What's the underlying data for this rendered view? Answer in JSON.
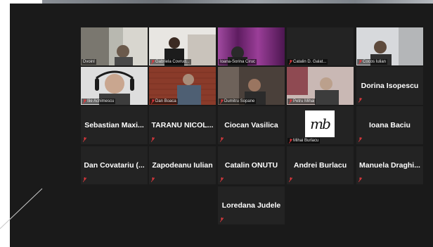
{
  "meeting": {
    "participants": [
      {
        "name": "Dvoinl",
        "view": "video"
      },
      {
        "name": "Gabriela Covrud...",
        "view": "video"
      },
      {
        "name": "Ioana-Sorina Ciruc",
        "view": "video",
        "active": true
      },
      {
        "name": "Catalin D. Galat...",
        "view": "video"
      },
      {
        "name": "Cocos Iulian",
        "view": "video"
      },
      {
        "name": "Ilie Achimescu",
        "view": "video"
      },
      {
        "name": "Dan Boaca",
        "view": "video"
      },
      {
        "name": "Dumitru Sopane",
        "view": "video"
      },
      {
        "name": "Petru Mihai",
        "view": "video"
      },
      {
        "name": "Dorina Isopescu",
        "view": "name"
      },
      {
        "name": "Sebastian Maxi...",
        "view": "name"
      },
      {
        "name": "TARANU NICOL...",
        "view": "name"
      },
      {
        "name": "Ciocan Vasilica",
        "view": "name"
      },
      {
        "name": "mb",
        "caption": "Mihai Burlacu",
        "view": "logo"
      },
      {
        "name": "Ioana Baciu",
        "view": "name"
      },
      {
        "name": "Dan Covatariu (...",
        "view": "name"
      },
      {
        "name": "Zapodeanu Iulian",
        "view": "name"
      },
      {
        "name": "Catalin ONUTU",
        "view": "name"
      },
      {
        "name": "Andrei Burlacu",
        "view": "name"
      },
      {
        "name": "Manuela Draghi...",
        "view": "name"
      },
      {
        "name": "Loredana Judele",
        "view": "name"
      }
    ]
  },
  "colors": {
    "background": "#1a1a1a",
    "tile": "#232323",
    "active_speaker": "#9bd12f",
    "muted_mic": "#e0393e"
  },
  "icons": {
    "muted": "microphone-muted-icon"
  }
}
